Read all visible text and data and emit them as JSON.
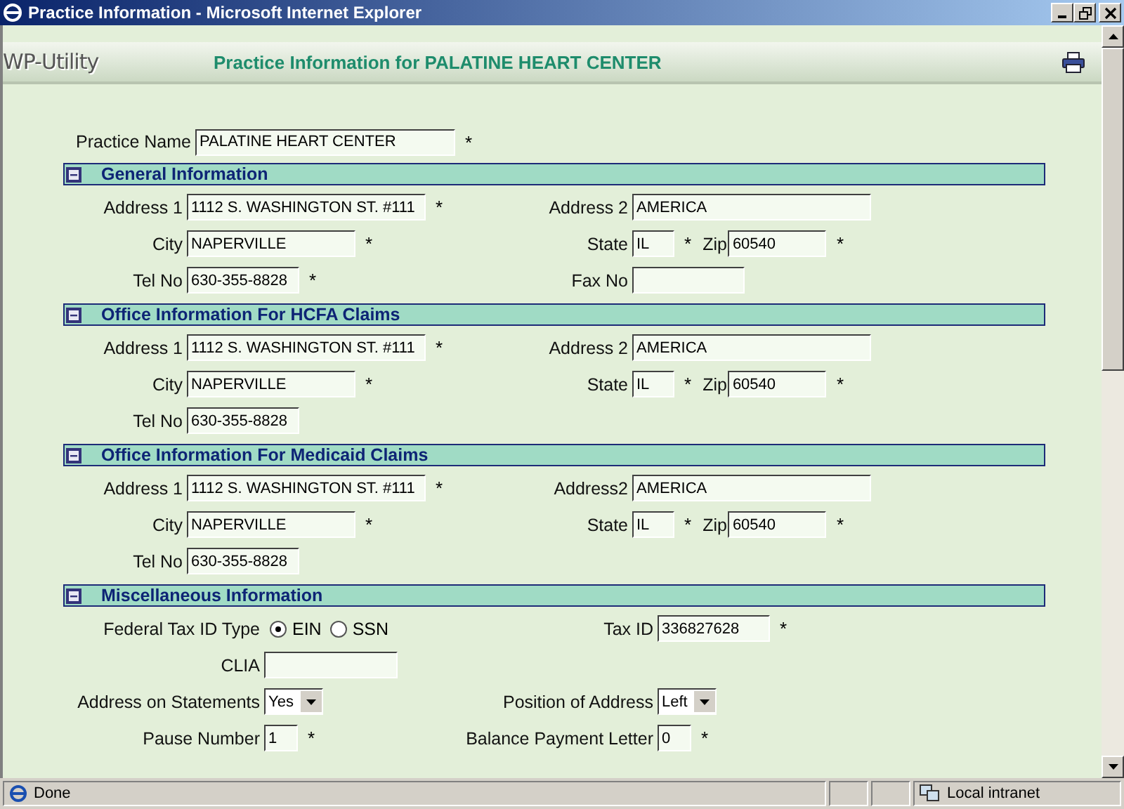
{
  "window": {
    "title": "Practice Information - Microsoft Internet Explorer"
  },
  "header": {
    "app_name": "WP-Utility",
    "title": "Practice Information for PALATINE HEART CENTER"
  },
  "required_mark": "*",
  "practice_name": {
    "label": "Practice Name",
    "kind": "name",
    "value": "PALATINE HEART CENTER",
    "required": true
  },
  "sections": [
    {
      "title": "General Information",
      "kind": "address",
      "expanded": true,
      "rows": [
        {
          "left": [
            {
              "label": "Address 1",
              "kind": "address",
              "value": "1112 S. WASHINGTON ST. #111",
              "required": true
            }
          ],
          "right": [
            {
              "label": "Address 2",
              "kind": "address",
              "value": "AMERICA",
              "required": false
            }
          ]
        },
        {
          "left": [
            {
              "label": "City",
              "kind": "city",
              "value": "NAPERVILLE",
              "required": true
            }
          ],
          "right": [
            {
              "label": "State",
              "kind": "state",
              "value": "IL",
              "required": true
            },
            {
              "label": "Zip",
              "kind": "zip",
              "value": "60540",
              "required": true
            }
          ]
        },
        {
          "left": [
            {
              "label": "Tel No",
              "kind": "phone",
              "value": "630-355-8828",
              "required": true
            }
          ],
          "right": [
            {
              "label": "Fax No",
              "kind": "phone",
              "required": false
            }
          ]
        }
      ]
    },
    {
      "title": "Office Information For HCFA Claims",
      "kind": "address",
      "expanded": true,
      "rows": [
        {
          "left": [
            {
              "label": "Address 1",
              "kind": "address",
              "value": "1112 S. WASHINGTON ST. #111",
              "required": true
            }
          ],
          "right": [
            {
              "label": "Address 2",
              "kind": "address",
              "value": "AMERICA",
              "required": false
            }
          ]
        },
        {
          "left": [
            {
              "label": "City",
              "kind": "city",
              "value": "NAPERVILLE",
              "required": true
            }
          ],
          "right": [
            {
              "label": "State",
              "kind": "state",
              "value": "IL",
              "required": true
            },
            {
              "label": "Zip",
              "kind": "zip",
              "value": "60540",
              "required": true
            }
          ]
        },
        {
          "left": [
            {
              "label": "Tel No",
              "kind": "phone",
              "value": "630-355-8828",
              "required": false
            }
          ],
          "right": []
        }
      ]
    },
    {
      "title": "Office Information For Medicaid Claims",
      "kind": "address",
      "expanded": true,
      "rows": [
        {
          "left": [
            {
              "label": "Address 1",
              "kind": "address",
              "value": "1112 S. WASHINGTON ST. #111",
              "required": true
            }
          ],
          "right": [
            {
              "label": "Address2",
              "kind": "address",
              "value": "AMERICA",
              "required": false
            }
          ]
        },
        {
          "left": [
            {
              "label": "City",
              "kind": "city",
              "value": "NAPERVILLE",
              "required": true
            }
          ],
          "right": [
            {
              "label": "State",
              "kind": "state",
              "value": "IL",
              "required": true
            },
            {
              "label": "Zip",
              "kind": "zip",
              "value": "60540",
              "required": true
            }
          ]
        },
        {
          "left": [
            {
              "label": "Tel No",
              "kind": "phone",
              "value": "630-355-8828",
              "required": false
            }
          ],
          "right": []
        }
      ]
    },
    {
      "title": "Miscellaneous Information",
      "kind": "misc",
      "expanded": true,
      "rows": [
        {
          "left": [
            {
              "label": "Federal Tax ID Type",
              "kind": "radio",
              "options": [
                {
                  "label": "EIN",
                  "selected": true
                },
                {
                  "label": "SSN",
                  "selected": false
                }
              ],
              "required": false
            }
          ],
          "right": [
            {
              "label": "Tax ID",
              "kind": "taxid",
              "value": "336827628",
              "required": true
            }
          ]
        },
        {
          "left": [
            {
              "label": "CLIA",
              "kind": "clia",
              "required": false
            }
          ],
          "right": []
        },
        {
          "left": [
            {
              "label": "Address on Statements",
              "kind": "select",
              "value": "Yes",
              "required": false
            }
          ],
          "right": [
            {
              "label": "Position of Address",
              "kind": "select",
              "value": "Left",
              "required": false
            }
          ]
        },
        {
          "left": [
            {
              "label": "Pause Number",
              "kind": "number",
              "value": "1",
              "required": true
            }
          ],
          "right": [
            {
              "label": "Balance Payment Letter",
              "kind": "number",
              "value": "0",
              "required": true
            }
          ]
        }
      ]
    }
  ],
  "status_bar": {
    "status": "Done",
    "zone": "Local intranet"
  }
}
